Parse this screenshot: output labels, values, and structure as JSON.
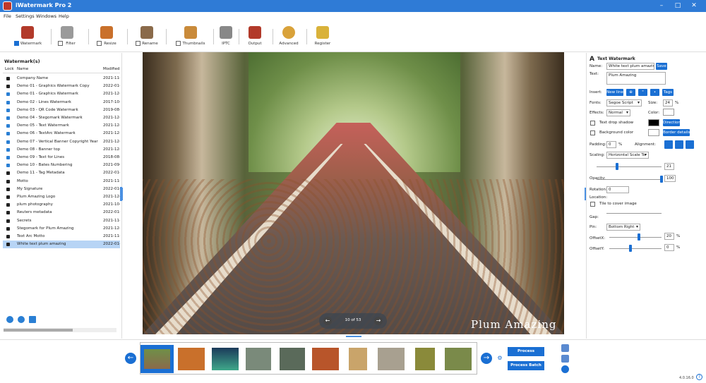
{
  "app": {
    "title": "iWatermark Pro 2",
    "version": "4.0.16.0"
  },
  "menu": [
    "File",
    "Settings",
    "Windows",
    "Help"
  ],
  "toolbar": [
    {
      "label": "Watermark",
      "checked": true,
      "icon": "watermark-icon"
    },
    {
      "label": "Filter",
      "checked": false,
      "icon": "filter-icon"
    },
    {
      "label": "Resize",
      "checked": false,
      "icon": "resize-icon"
    },
    {
      "label": "Rename",
      "checked": false,
      "icon": "rename-icon"
    },
    {
      "label": "Thumbnails",
      "checked": false,
      "icon": "thumbnails-icon"
    },
    {
      "label": "IPTC",
      "icon": "iptc-icon"
    },
    {
      "label": "Output",
      "icon": "output-icon"
    },
    {
      "label": "Advanced",
      "icon": "gear-icon"
    },
    {
      "label": "Register",
      "icon": "key-icon"
    }
  ],
  "watermarks": {
    "header": "Watermark(s)",
    "col_lock": "Lock",
    "col_name": "Name",
    "col_modified": "Modified",
    "rows": [
      {
        "name": "Company Name",
        "modified": "2021-11-",
        "locked": true
      },
      {
        "name": "Demo 01 - Graphics Watermark Copy",
        "modified": "2022-01-",
        "locked": true
      },
      {
        "name": "Demo 01 - Graphics Watermark",
        "modified": "2021-12-",
        "locked": false
      },
      {
        "name": "Demo 02 - Lines Watermark",
        "modified": "2017-10-",
        "locked": false
      },
      {
        "name": "Demo 03 - QR Code Watermark",
        "modified": "2019-08-",
        "locked": false
      },
      {
        "name": "Demo 04 - Stegomark Watermark",
        "modified": "2021-12-",
        "locked": false
      },
      {
        "name": "Demo 05 - Text Watermark",
        "modified": "2021-12-",
        "locked": false
      },
      {
        "name": "Demo 06 - TextArc Watermark",
        "modified": "2021-12-",
        "locked": false
      },
      {
        "name": "Demo 07 - Vertical Banner Copyright Year",
        "modified": "2021-12-",
        "locked": false
      },
      {
        "name": "Demo 08 - Banner top",
        "modified": "2021-12-",
        "locked": false
      },
      {
        "name": "Demo 09 - Text for Lines",
        "modified": "2018-08-",
        "locked": false
      },
      {
        "name": "Demo 10 - Bates Numbering",
        "modified": "2021-09-",
        "locked": false
      },
      {
        "name": "Demo 11 - Tag Metadata",
        "modified": "2022-01-",
        "locked": true
      },
      {
        "name": "Motto",
        "modified": "2021-11-",
        "locked": true
      },
      {
        "name": "My Signature",
        "modified": "2022-01-",
        "locked": true
      },
      {
        "name": "Plum Amazing Logo",
        "modified": "2021-12-",
        "locked": true
      },
      {
        "name": "plum photography",
        "modified": "2021-10-",
        "locked": true
      },
      {
        "name": "Reuters metadata",
        "modified": "2022-01-",
        "locked": true
      },
      {
        "name": "Secrets",
        "modified": "2021-11-",
        "locked": true
      },
      {
        "name": "Stegomark for Plum Amazing",
        "modified": "2021-12-",
        "locked": true
      },
      {
        "name": "Text Arc Motto",
        "modified": "2021-11-",
        "locked": true
      },
      {
        "name": "White text plum amazing",
        "modified": "2022-01-",
        "locked": true,
        "selected": true
      }
    ]
  },
  "preview": {
    "watermark_text": "Plum Amazing",
    "pager": "10 of 53"
  },
  "panel": {
    "title": "Text Watermark",
    "name_label": "Name:",
    "name_value": "White text plum amazing",
    "save": "Save",
    "text_label": "Text:",
    "text_value": "Plum Amazing",
    "insert_label": "Insert:",
    "new_line": "New line",
    "insert_btn2": "⊕",
    "insert_btn3": "\"",
    "insert_btn4": "•",
    "tags": "Tags",
    "fonts_label": "Fonts:",
    "font_value": "Segoe Script",
    "size_label": "Size:",
    "size_value": "24",
    "size_unit": "%",
    "effects_label": "Effects:",
    "effects_value": "Normal",
    "color_label": "Color:",
    "text_color": "#ffffff",
    "drop_shadow": "Text drop shadow",
    "shadow_color": "#000000",
    "direction": "Direction",
    "bg_color": "Background color",
    "bg_swatch": "#ffffff",
    "border_details": "Border details",
    "padding_label": "Padding:",
    "padding_value": "0",
    "padding_unit": "%",
    "alignment_label": "Alignment:",
    "scaling_label": "Scaling:",
    "scaling_value": "Horizontal Scale To",
    "scaling_num": "21",
    "scaling_fraction": 0.21,
    "opacity_label": "Opacity:",
    "opacity_value": "100",
    "opacity_fraction": 1.0,
    "rotation_label": "Rotation:",
    "rotation_value": "0",
    "location_label": "Location:",
    "tile": "Tile to cover image",
    "gap_label": "Gap:",
    "pin_label": "Pin:",
    "pin_value": "Bottom Right",
    "offsetx_label": "OffsetX:",
    "offsetx_value": "20",
    "offsetx_unit": "%",
    "offsety_label": "OffsetY:",
    "offsety_value": "0",
    "offsety_unit": "%"
  },
  "actions": {
    "process_selection": "Process Selection",
    "process_batch": "Process Batch"
  },
  "colors": {
    "accent": "#1a6fd3",
    "titlebar": "#2f7bd6",
    "selected_row": "#b7d4f5"
  }
}
